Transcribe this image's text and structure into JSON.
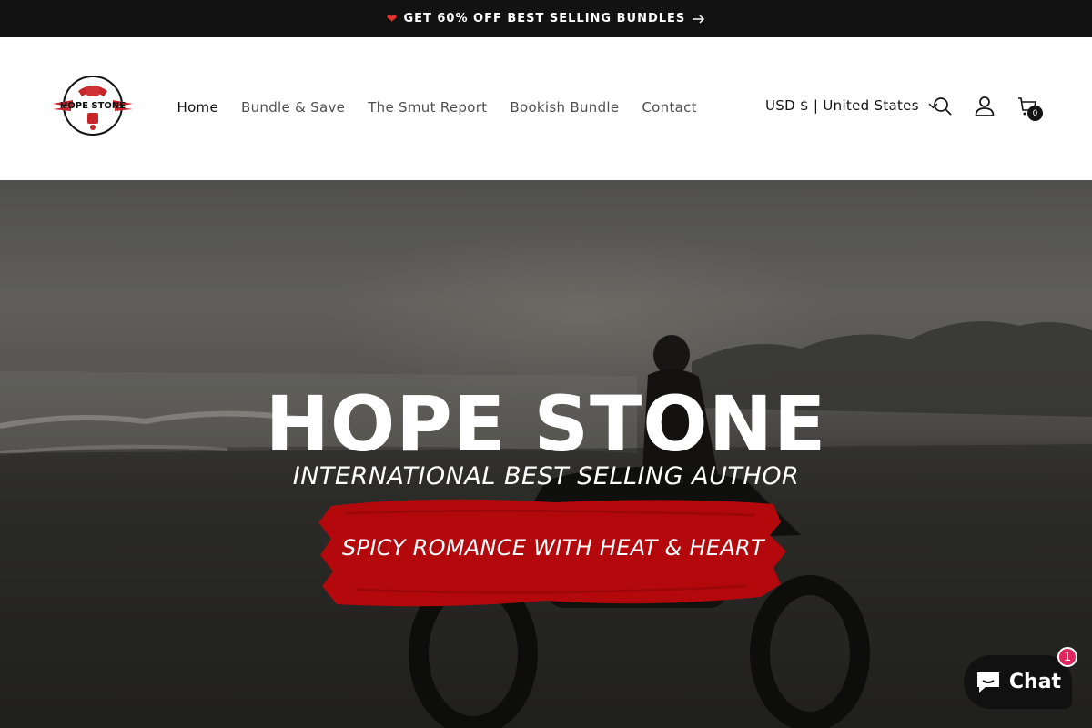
{
  "announcement": {
    "heart_icon": "heart-icon",
    "text": "GET 60% OFF BEST SELLING BUNDLES",
    "arrow_icon": "arrow-right-icon"
  },
  "header": {
    "logo_text": "HOPE STONE",
    "nav": [
      {
        "label": "Home",
        "active": true
      },
      {
        "label": "Bundle & Save",
        "active": false
      },
      {
        "label": "The Smut Report",
        "active": false
      },
      {
        "label": "Bookish Bundle",
        "active": false
      },
      {
        "label": "Contact",
        "active": false
      }
    ],
    "country_selector": "USD $ | United States",
    "cart_count": "0",
    "icons": [
      "search-icon",
      "account-icon",
      "cart-icon"
    ]
  },
  "hero": {
    "title": "HOPE STONE",
    "subtitle": "INTERNATIONAL BEST SELLING AUTHOR",
    "tagline": "SPICY ROMANCE WITH HEAT & HEART",
    "brush_color": "#b3090c"
  },
  "chat": {
    "label": "Chat",
    "badge": "1"
  },
  "colors": {
    "announcement_bg": "#121212",
    "text": "#121212",
    "accent_red": "#b3090c",
    "chat_badge": "#e0245e"
  }
}
